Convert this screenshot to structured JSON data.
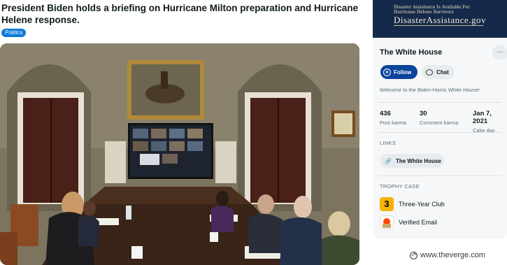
{
  "post": {
    "title": "President Biden holds a briefing on Hurricane Milton preparation and Hurricane Helene response.",
    "flair": "Politics"
  },
  "sidebar": {
    "banner_small_line1": "Disaster Assistance Is Available For",
    "banner_small_line2": "Hurricane Helene Survivors",
    "banner_big": "DisasterAssistance.gov",
    "title": "The White House",
    "more_label": "···",
    "follow_label": "Follow",
    "chat_label": "Chat",
    "welcome": "Welcome to the Biden-Harris White House!",
    "stats": [
      {
        "value": "436",
        "label": "Post karma"
      },
      {
        "value": "30",
        "label": "Comment karma"
      },
      {
        "value": "Jan 7, 2021",
        "label": "Cake day"
      }
    ],
    "links_header": "LINKS",
    "link_label": "The White House",
    "trophy_header": "TROPHY CASE",
    "trophies": [
      {
        "icon_text": "3",
        "label": "Three-Year Club"
      },
      {
        "icon_text": "",
        "label": "Verified Email"
      }
    ]
  },
  "credit": {
    "text": "www.theverge.com"
  },
  "colors": {
    "follow_blue": "#0a449b",
    "flair_blue": "#0a7ad6",
    "banner_navy": "#152a4a",
    "trophy_gold": "#f4b400"
  }
}
